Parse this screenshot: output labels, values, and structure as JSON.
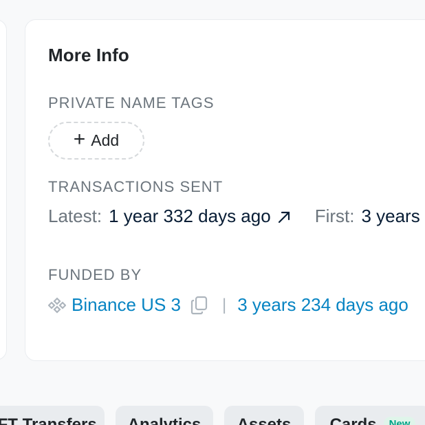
{
  "card": {
    "title": "More Info",
    "private_name_tags": {
      "label": "PRIVATE NAME TAGS",
      "add_label": "Add"
    },
    "transactions_sent": {
      "label": "TRANSACTIONS SENT",
      "latest_label": "Latest:",
      "latest_value": "1 year 332 days ago",
      "first_label": "First:",
      "first_value": "3 years"
    },
    "funded_by": {
      "label": "FUNDED BY",
      "source": "Binance US 3",
      "separator": "|",
      "age": "3 years 234 days ago"
    }
  },
  "tabs": [
    {
      "label": "NFT Transfers"
    },
    {
      "label": "Analytics"
    },
    {
      "label": "Assets"
    },
    {
      "label": "Cards",
      "badge": "New"
    }
  ],
  "colors": {
    "link": "#0784c3",
    "muted": "#6c757d",
    "badge_bg": "#dff5ea",
    "badge_text": "#00a186"
  }
}
